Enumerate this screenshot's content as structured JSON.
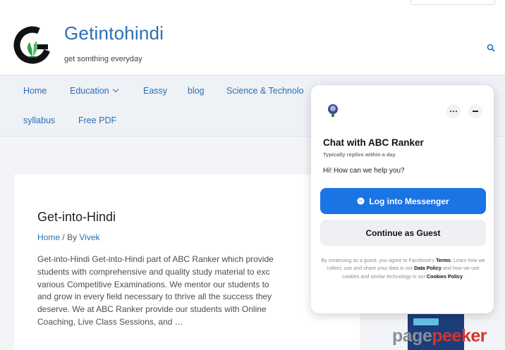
{
  "site": {
    "title": "Getintohindi",
    "tagline": "get somthing everyday"
  },
  "nav": {
    "items": [
      "Home",
      "Education",
      "Eassy",
      "blog",
      "Science & Technolo",
      "syllabus",
      "Free PDF"
    ]
  },
  "article": {
    "title": "Get-into-Hindi",
    "meta_home": "Home",
    "meta_sep": " / By ",
    "meta_author": "Vivek",
    "excerpt_lines": [
      "Get-into-Hindi   Get-into-Hindi part of ABC Ranker which provide",
      "students with comprehensive and quality study material to exc",
      "various Competitive Examinations. We mentor our students to",
      "and grow in every field necessary to thrive all the success they",
      "deserve. We at ABC Ranker provide our students with Online",
      "Coaching, Live Class Sessions, and …"
    ]
  },
  "chat": {
    "title": "Chat with ABC Ranker",
    "subtitle": "Typically replies within a day",
    "greeting": "Hi! How can we help you?",
    "messenger_label": "Log into Messenger",
    "guest_label": "Continue as Guest",
    "legal": {
      "p1": "By continuing as a guest, you agree to Facebook's ",
      "terms": "Terms",
      "p2": ". Learn how we collect, use and share your data in our ",
      "data_policy": "Data Policy",
      "p3": " and how we use cookies and similar technology in our ",
      "cookies_policy": "Cookies Policy",
      "p4": "."
    }
  },
  "watermark": {
    "part1": "page",
    "part2": "peeker"
  },
  "colors": {
    "link": "#2b6fb5",
    "messenger_blue": "#1b74e4",
    "nav_bg": "#eef1f6",
    "watermark_red": "#d9332a"
  },
  "icons": {
    "search": "search-icon",
    "logo": "logo-icon",
    "chat_avatar": "chat-avatar-icon",
    "more": "more-icon",
    "minimize": "minimize-icon",
    "messenger": "messenger-icon"
  }
}
